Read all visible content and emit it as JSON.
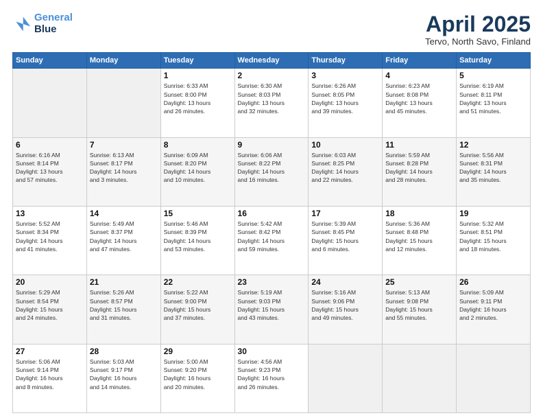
{
  "header": {
    "logo_line1": "General",
    "logo_line2": "Blue",
    "title": "April 2025",
    "subtitle": "Tervo, North Savo, Finland"
  },
  "days_of_week": [
    "Sunday",
    "Monday",
    "Tuesday",
    "Wednesday",
    "Thursday",
    "Friday",
    "Saturday"
  ],
  "weeks": [
    [
      {
        "day": "",
        "info": ""
      },
      {
        "day": "",
        "info": ""
      },
      {
        "day": "1",
        "info": "Sunrise: 6:33 AM\nSunset: 8:00 PM\nDaylight: 13 hours\nand 26 minutes."
      },
      {
        "day": "2",
        "info": "Sunrise: 6:30 AM\nSunset: 8:03 PM\nDaylight: 13 hours\nand 32 minutes."
      },
      {
        "day": "3",
        "info": "Sunrise: 6:26 AM\nSunset: 8:05 PM\nDaylight: 13 hours\nand 39 minutes."
      },
      {
        "day": "4",
        "info": "Sunrise: 6:23 AM\nSunset: 8:08 PM\nDaylight: 13 hours\nand 45 minutes."
      },
      {
        "day": "5",
        "info": "Sunrise: 6:19 AM\nSunset: 8:11 PM\nDaylight: 13 hours\nand 51 minutes."
      }
    ],
    [
      {
        "day": "6",
        "info": "Sunrise: 6:16 AM\nSunset: 8:14 PM\nDaylight: 13 hours\nand 57 minutes."
      },
      {
        "day": "7",
        "info": "Sunrise: 6:13 AM\nSunset: 8:17 PM\nDaylight: 14 hours\nand 3 minutes."
      },
      {
        "day": "8",
        "info": "Sunrise: 6:09 AM\nSunset: 8:20 PM\nDaylight: 14 hours\nand 10 minutes."
      },
      {
        "day": "9",
        "info": "Sunrise: 6:06 AM\nSunset: 8:22 PM\nDaylight: 14 hours\nand 16 minutes."
      },
      {
        "day": "10",
        "info": "Sunrise: 6:03 AM\nSunset: 8:25 PM\nDaylight: 14 hours\nand 22 minutes."
      },
      {
        "day": "11",
        "info": "Sunrise: 5:59 AM\nSunset: 8:28 PM\nDaylight: 14 hours\nand 28 minutes."
      },
      {
        "day": "12",
        "info": "Sunrise: 5:56 AM\nSunset: 8:31 PM\nDaylight: 14 hours\nand 35 minutes."
      }
    ],
    [
      {
        "day": "13",
        "info": "Sunrise: 5:52 AM\nSunset: 8:34 PM\nDaylight: 14 hours\nand 41 minutes."
      },
      {
        "day": "14",
        "info": "Sunrise: 5:49 AM\nSunset: 8:37 PM\nDaylight: 14 hours\nand 47 minutes."
      },
      {
        "day": "15",
        "info": "Sunrise: 5:46 AM\nSunset: 8:39 PM\nDaylight: 14 hours\nand 53 minutes."
      },
      {
        "day": "16",
        "info": "Sunrise: 5:42 AM\nSunset: 8:42 PM\nDaylight: 14 hours\nand 59 minutes."
      },
      {
        "day": "17",
        "info": "Sunrise: 5:39 AM\nSunset: 8:45 PM\nDaylight: 15 hours\nand 6 minutes."
      },
      {
        "day": "18",
        "info": "Sunrise: 5:36 AM\nSunset: 8:48 PM\nDaylight: 15 hours\nand 12 minutes."
      },
      {
        "day": "19",
        "info": "Sunrise: 5:32 AM\nSunset: 8:51 PM\nDaylight: 15 hours\nand 18 minutes."
      }
    ],
    [
      {
        "day": "20",
        "info": "Sunrise: 5:29 AM\nSunset: 8:54 PM\nDaylight: 15 hours\nand 24 minutes."
      },
      {
        "day": "21",
        "info": "Sunrise: 5:26 AM\nSunset: 8:57 PM\nDaylight: 15 hours\nand 31 minutes."
      },
      {
        "day": "22",
        "info": "Sunrise: 5:22 AM\nSunset: 9:00 PM\nDaylight: 15 hours\nand 37 minutes."
      },
      {
        "day": "23",
        "info": "Sunrise: 5:19 AM\nSunset: 9:03 PM\nDaylight: 15 hours\nand 43 minutes."
      },
      {
        "day": "24",
        "info": "Sunrise: 5:16 AM\nSunset: 9:06 PM\nDaylight: 15 hours\nand 49 minutes."
      },
      {
        "day": "25",
        "info": "Sunrise: 5:13 AM\nSunset: 9:08 PM\nDaylight: 15 hours\nand 55 minutes."
      },
      {
        "day": "26",
        "info": "Sunrise: 5:09 AM\nSunset: 9:11 PM\nDaylight: 16 hours\nand 2 minutes."
      }
    ],
    [
      {
        "day": "27",
        "info": "Sunrise: 5:06 AM\nSunset: 9:14 PM\nDaylight: 16 hours\nand 8 minutes."
      },
      {
        "day": "28",
        "info": "Sunrise: 5:03 AM\nSunset: 9:17 PM\nDaylight: 16 hours\nand 14 minutes."
      },
      {
        "day": "29",
        "info": "Sunrise: 5:00 AM\nSunset: 9:20 PM\nDaylight: 16 hours\nand 20 minutes."
      },
      {
        "day": "30",
        "info": "Sunrise: 4:56 AM\nSunset: 9:23 PM\nDaylight: 16 hours\nand 26 minutes."
      },
      {
        "day": "",
        "info": ""
      },
      {
        "day": "",
        "info": ""
      },
      {
        "day": "",
        "info": ""
      }
    ]
  ]
}
